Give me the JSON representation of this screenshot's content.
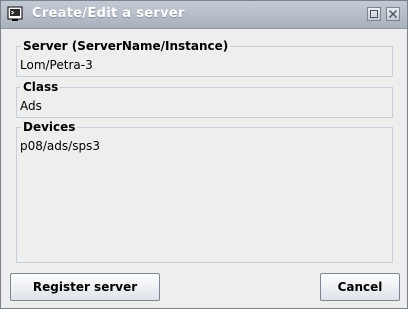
{
  "window": {
    "title": "Create/Edit a server",
    "icon": "terminal-app-icon",
    "controls": [
      "maximize-icon",
      "close-icon"
    ]
  },
  "form": {
    "server": {
      "label": "Server  (ServerName/Instance)",
      "value": "Lom/Petra-3"
    },
    "class": {
      "label": "Class",
      "value": "Ads"
    },
    "devices": {
      "label": "Devices",
      "value": "p08/ads/sps3"
    }
  },
  "buttons": {
    "register": "Register server",
    "cancel": "Cancel"
  }
}
